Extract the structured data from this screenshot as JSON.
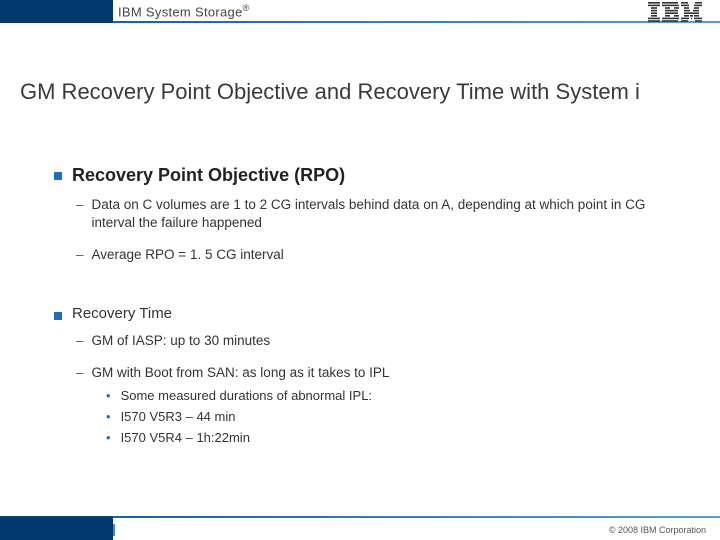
{
  "header": {
    "brand_prefix": "IBM System Storage",
    "brand_suffix": "®"
  },
  "title": "GM Recovery Point Objective and Recovery Time with System i",
  "sections": [
    {
      "title": "Recovery Point Objective (RPO)",
      "emphasis": true,
      "subs": [
        {
          "text": "Data on C volumes are 1 to 2 CG intervals behind data on A, depending at which point in CG interval the failure happened"
        },
        {
          "text": "Average RPO  =  1. 5  CG interval"
        }
      ]
    },
    {
      "title": "Recovery Time",
      "emphasis": false,
      "subs": [
        {
          "text": "GM of IASP:  up to 30 minutes"
        },
        {
          "text": "GM with Boot from SAN: as long as it takes to IPL",
          "dots": [
            "Some measured durations of abnormal IPL:",
            "I570 V5R3 – 44 min",
            "I570 V5R4 – 1h:22min"
          ]
        }
      ]
    }
  ],
  "footer": {
    "copyright": "© 2008 IBM Corporation"
  }
}
